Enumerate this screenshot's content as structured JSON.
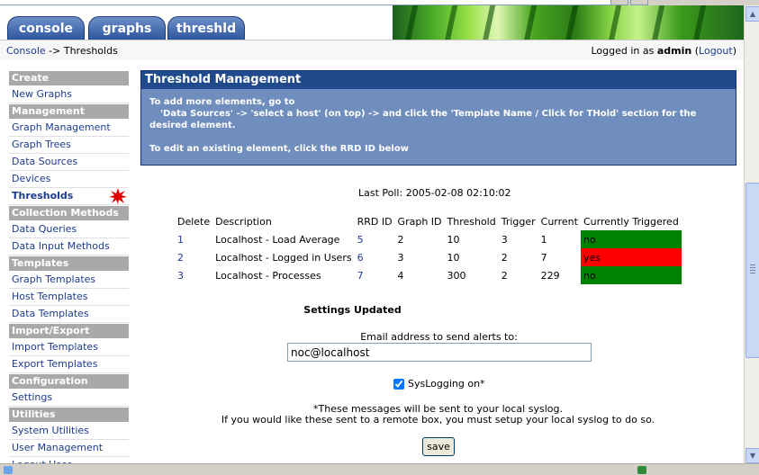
{
  "tabs": [
    {
      "label": "console"
    },
    {
      "label": "graphs"
    },
    {
      "label": "threshld"
    }
  ],
  "breadcrumb": {
    "root": "Console",
    "separator": " -> ",
    "current": "Thresholds"
  },
  "login": {
    "prefix": "Logged in as ",
    "user": "admin",
    "logout": "Logout"
  },
  "sidebar": {
    "sections": [
      {
        "header": "Create",
        "items": [
          "New Graphs"
        ]
      },
      {
        "header": "Management",
        "items": [
          "Graph Management",
          "Graph Trees",
          "Data Sources",
          "Devices",
          "Thresholds"
        ]
      },
      {
        "header": "Collection Methods",
        "items": [
          "Data Queries",
          "Data Input Methods"
        ]
      },
      {
        "header": "Templates",
        "items": [
          "Graph Templates",
          "Host Templates",
          "Data Templates"
        ]
      },
      {
        "header": "Import/Export",
        "items": [
          "Import Templates",
          "Export Templates"
        ]
      },
      {
        "header": "Configuration",
        "items": [
          "Settings"
        ]
      },
      {
        "header": "Utilities",
        "items": [
          "System Utilities",
          "User Management",
          "Logout User"
        ]
      }
    ],
    "active": "Thresholds"
  },
  "panel": {
    "title": "Threshold Management",
    "line1": "To add more elements, go to",
    "line2": "'Data Sources' -> 'select a host' (on top) -> and click the 'Template Name / Click for THold' section for the",
    "line3": "desired element.",
    "line4": "To edit an existing element, click the RRD ID below"
  },
  "last_poll": "Last Poll: 2005-02-08 02:10:02",
  "table": {
    "headers": [
      "Delete",
      "Description",
      "RRD ID",
      "Graph ID",
      "Threshold",
      "Trigger",
      "Current",
      "Currently Triggered"
    ],
    "rows": [
      {
        "delete": "1",
        "description": "Localhost - Load Average",
        "rrd": "5",
        "graph": "2",
        "threshold": "10",
        "trigger": "3",
        "current": "1",
        "triggered": "no"
      },
      {
        "delete": "2",
        "description": "Localhost - Logged in Users",
        "rrd": "6",
        "graph": "3",
        "threshold": "10",
        "trigger": "2",
        "current": "7",
        "triggered": "yes"
      },
      {
        "delete": "3",
        "description": "Localhost - Processes",
        "rrd": "7",
        "graph": "4",
        "threshold": "300",
        "trigger": "2",
        "current": "229",
        "triggered": "no"
      }
    ]
  },
  "settings": {
    "updated": "Settings Updated",
    "email_label": "Email address to send alerts to:",
    "email_value": "noc@localhost",
    "syslog_label": "SysLogging on*",
    "syslog_checked": true,
    "note1": "*These messages will be sent to your local syslog.",
    "note2": "If you would like these sent to a remote box, you must setup your local syslog to do so.",
    "save": "save"
  },
  "colors": {
    "triggered_no": "#008000",
    "triggered_yes": "#ff0000",
    "panel_title_bg": "#1f4a8c",
    "panel_body_bg": "#6f8dbd",
    "nav_header_bg": "#a9a9a9"
  },
  "icons": {
    "active_marker": "red-starburst-icon"
  }
}
